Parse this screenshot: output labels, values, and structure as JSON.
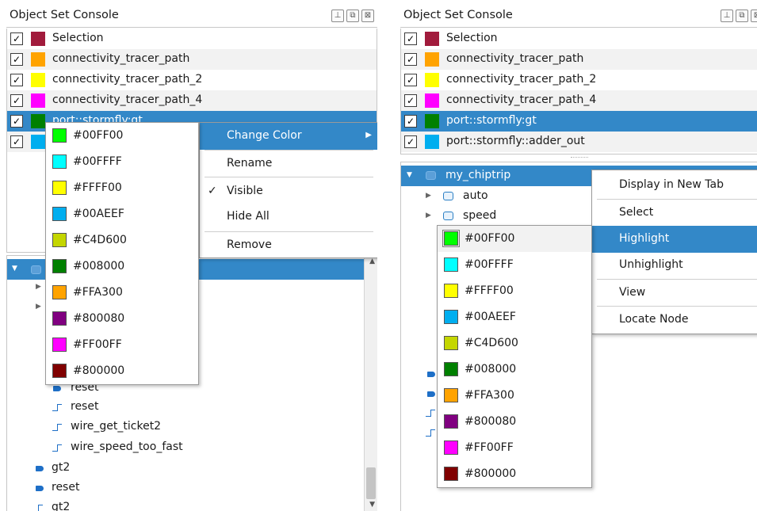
{
  "colors": {
    "selection": "#A11B3C",
    "orange": "#FFA300",
    "yellow": "#FFFF00",
    "magenta": "#FF00FF",
    "green": "#008000",
    "cyan_blue": "#00AEEF",
    "selection_blue": "#3388C8"
  },
  "left": {
    "title": "Object Set Console",
    "buttons": [
      "⊥",
      "⧉",
      "⊠"
    ],
    "objects": [
      {
        "label": "Selection",
        "checked": "✓"
      },
      {
        "label": "connectivity_tracer_path",
        "checked": "✓"
      },
      {
        "label": "connectivity_tracer_path_2",
        "checked": "✓"
      },
      {
        "label": "connectivity_tracer_path_4",
        "checked": "✓"
      },
      {
        "label": "port::stormfly:gt",
        "checked": "✓"
      },
      {
        "label": "",
        "checked": "✓"
      }
    ],
    "tree": [
      {
        "label": "reset",
        "icon": "port-icon"
      },
      {
        "label": "reset",
        "icon": "wire-icon"
      },
      {
        "label": "wire_get_ticket2",
        "icon": "wire-icon"
      },
      {
        "label": "wire_speed_too_fast",
        "icon": "wire-icon"
      },
      {
        "label": "gt2",
        "icon": "port-icon"
      },
      {
        "label": "reset",
        "icon": "port-icon"
      },
      {
        "label": "gt2",
        "icon": "wire-icon"
      }
    ],
    "context_menu": {
      "change_color": "Change Color",
      "rename": "Rename",
      "visible": "Visible",
      "visible_check": "✓",
      "hide_all": "Hide All",
      "remove": "Remove"
    },
    "color_menu": [
      "#00FF00",
      "#00FFFF",
      "#FFFF00",
      "#00AEEF",
      "#C4D600",
      "#008000",
      "#FFA300",
      "#800080",
      "#FF00FF",
      "#800000"
    ]
  },
  "right": {
    "title": "Object Set Console",
    "buttons": [
      "⊥",
      "⧉",
      "⊠"
    ],
    "objects": [
      {
        "label": "Selection",
        "checked": "✓"
      },
      {
        "label": "connectivity_tracer_path",
        "checked": "✓"
      },
      {
        "label": "connectivity_tracer_path_2",
        "checked": "✓"
      },
      {
        "label": "connectivity_tracer_path_4",
        "checked": "✓"
      },
      {
        "label": "port::stormfly:gt",
        "checked": "✓"
      },
      {
        "label": "port::stormfly::adder_out",
        "checked": "✓"
      }
    ],
    "tree": [
      {
        "label": "my_chiptrip"
      },
      {
        "label": "auto"
      },
      {
        "label": "speed"
      }
    ],
    "context_menu": {
      "display_new_tab": "Display in New Tab",
      "select": "Select",
      "highlight": "Highlight",
      "unhighlight": "Unhighlight",
      "view": "View",
      "locate_node": "Locate Node"
    },
    "color_menu": [
      "#00FF00",
      "#00FFFF",
      "#FFFF00",
      "#00AEEF",
      "#C4D600",
      "#008000",
      "#FFA300",
      "#800080",
      "#FF00FF",
      "#800000"
    ]
  }
}
